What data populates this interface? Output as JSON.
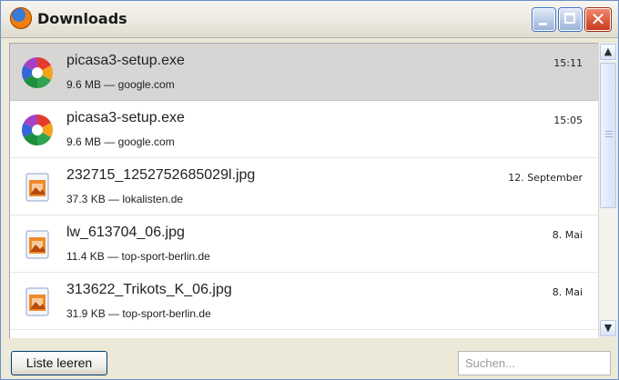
{
  "window": {
    "title": "Downloads"
  },
  "downloads": [
    {
      "filename": "picasa3-setup.exe",
      "meta": "9.6 MB — google.com",
      "time": "15:11",
      "selected": true,
      "icon": "picasa-icon"
    },
    {
      "filename": "picasa3-setup.exe",
      "meta": "9.6 MB — google.com",
      "time": "15:05",
      "selected": false,
      "icon": "picasa-icon"
    },
    {
      "filename": "232715_1252752685029l.jpg",
      "meta": "37.3 KB — lokalisten.de",
      "time": "12. September",
      "selected": false,
      "icon": "image-file-icon"
    },
    {
      "filename": "lw_613704_06.jpg",
      "meta": "11.4 KB — top-sport-berlin.de",
      "time": "8. Mai",
      "selected": false,
      "icon": "image-file-icon"
    },
    {
      "filename": "313622_Trikots_K_06.jpg",
      "meta": "31.9 KB — top-sport-berlin.de",
      "time": "8. Mai",
      "selected": false,
      "icon": "image-file-icon"
    }
  ],
  "footer": {
    "clear_label": "Liste leeren",
    "search_placeholder": "Suchen..."
  },
  "colors": {
    "selection": "#d7d6d5",
    "title_bar": "#ebe9e0",
    "close_button": "#c8391b"
  }
}
